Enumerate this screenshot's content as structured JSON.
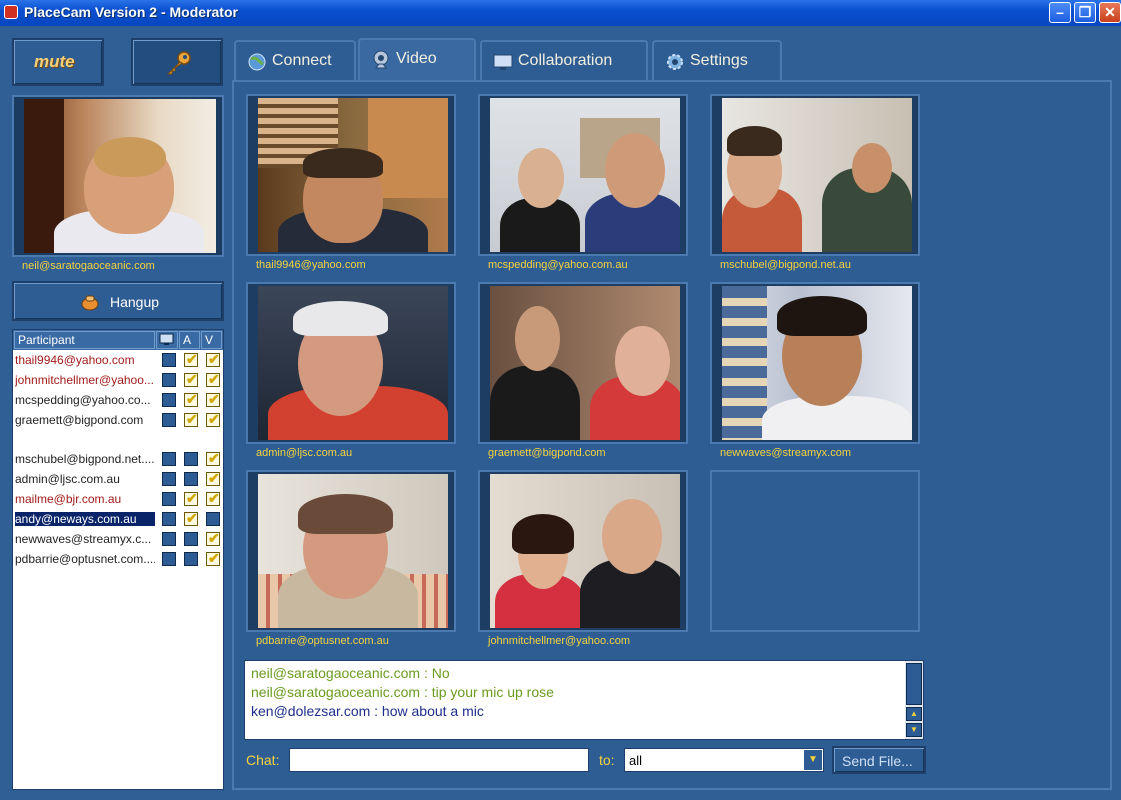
{
  "window": {
    "title": "PlaceCam Version 2 - Moderator",
    "controls": [
      "minimize",
      "restore",
      "close"
    ]
  },
  "left_panel": {
    "mute_label": "mute",
    "key_icon": "key-icon",
    "self_video_label": "neil@saratogaoceanic.com",
    "hangup_label": "Hangup"
  },
  "participants": {
    "columns": {
      "name": "Participant",
      "icon": "screen-icon",
      "audio": "A",
      "video": "V"
    },
    "rows": [
      {
        "name": "thail9946@yahoo.com",
        "color": "#a11b1b",
        "box1": false,
        "audio": true,
        "video": true
      },
      {
        "name": "johnmitchellmer@yahoo...",
        "color": "#a11b1b",
        "box1": false,
        "audio": true,
        "video": true
      },
      {
        "name": "mcspedding@yahoo.co...",
        "color": "#222222",
        "box1": false,
        "audio": true,
        "video": true
      },
      {
        "name": "graemett@bigpond.com",
        "color": "#222222",
        "box1": false,
        "audio": true,
        "video": true
      },
      {
        "name": "mschubel@bigpond.net....",
        "color": "#222222",
        "box1": false,
        "audio": false,
        "video": true
      },
      {
        "name": "admin@ljsc.com.au",
        "color": "#222222",
        "box1": false,
        "audio": false,
        "video": true
      },
      {
        "name": "mailme@bjr.com.au",
        "color": "#a11b1b",
        "box1": false,
        "audio": true,
        "video": true
      },
      {
        "name": "andy@neways.com.au",
        "color": "#ffffff",
        "box1": false,
        "audio": true,
        "video": false,
        "selected": true
      },
      {
        "name": "newwaves@streamyx.c...",
        "color": "#222222",
        "box1": false,
        "audio": false,
        "video": true
      },
      {
        "name": "pdbarrie@optusnet.com....",
        "color": "#222222",
        "box1": false,
        "audio": false,
        "video": true
      }
    ]
  },
  "tabs": [
    {
      "label": "Connect",
      "icon": "globe-icon",
      "active": false
    },
    {
      "label": "Video",
      "icon": "webcam-icon",
      "active": true
    },
    {
      "label": "Collaboration",
      "icon": "monitor-icon",
      "active": false
    },
    {
      "label": "Settings",
      "icon": "gear-icon",
      "active": false
    }
  ],
  "video_grid": [
    {
      "label": "thail9946@yahoo.com"
    },
    {
      "label": "mcspedding@yahoo.com.au"
    },
    {
      "label": "mschubel@bigpond.net.au"
    },
    {
      "label": "admin@ljsc.com.au"
    },
    {
      "label": "graemett@bigpond.com"
    },
    {
      "label": "newwaves@streamyx.com"
    },
    {
      "label": "pdbarrie@optusnet.com.au"
    },
    {
      "label": "johnmitchellmer@yahoo.com"
    },
    {
      "label": ""
    }
  ],
  "chat": {
    "lines": [
      {
        "text": "neil@saratogaoceanic.com : No",
        "color": "#6b9a1e"
      },
      {
        "text": "neil@saratogaoceanic.com : tip your mic up rose",
        "color": "#6b9a1e"
      },
      {
        "text": "ken@dolezsar.com : how about a mic",
        "color": "#1d2e8a"
      }
    ],
    "chat_label": "Chat:",
    "input_value": "",
    "to_label": "to:",
    "to_value": "all",
    "send_file_label": "Send File..."
  }
}
